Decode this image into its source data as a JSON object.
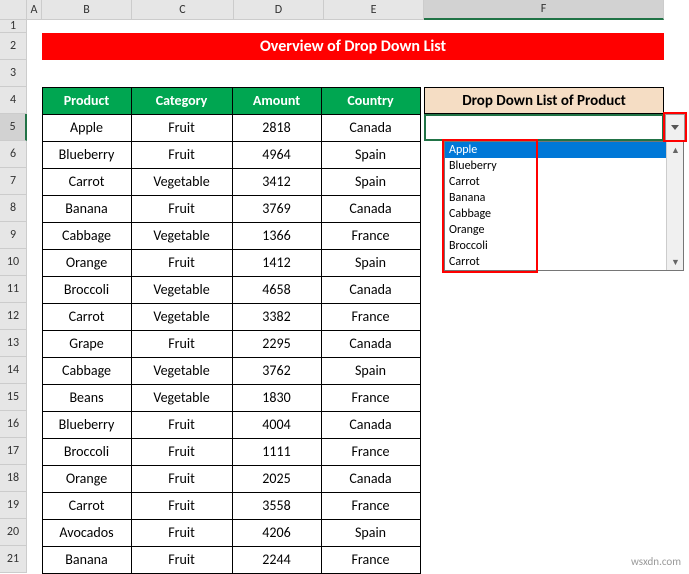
{
  "title": "Overview of Drop Down List",
  "columns": [
    "A",
    "B",
    "C",
    "D",
    "E",
    "F"
  ],
  "row_numbers": [
    "1",
    "2",
    "3",
    "4",
    "5",
    "6",
    "7",
    "8",
    "9",
    "10",
    "11",
    "12",
    "13",
    "14",
    "15",
    "16",
    "17",
    "18",
    "19",
    "20",
    "21"
  ],
  "headers": {
    "product": "Product",
    "category": "Category",
    "amount": "Amount",
    "country": "Country",
    "dropdown": "Drop Down List of Product"
  },
  "rows": [
    {
      "product": "Apple",
      "category": "Fruit",
      "amount": "2818",
      "country": "Canada"
    },
    {
      "product": "Blueberry",
      "category": "Fruit",
      "amount": "4964",
      "country": "Spain"
    },
    {
      "product": "Carrot",
      "category": "Vegetable",
      "amount": "3412",
      "country": "Spain"
    },
    {
      "product": "Banana",
      "category": "Fruit",
      "amount": "3769",
      "country": "Canada"
    },
    {
      "product": "Cabbage",
      "category": "Vegetable",
      "amount": "1366",
      "country": "France"
    },
    {
      "product": "Orange",
      "category": "Fruit",
      "amount": "1412",
      "country": "Spain"
    },
    {
      "product": "Broccoli",
      "category": "Vegetable",
      "amount": "4658",
      "country": "Canada"
    },
    {
      "product": "Carrot",
      "category": "Vegetable",
      "amount": "3382",
      "country": "France"
    },
    {
      "product": "Grape",
      "category": "Fruit",
      "amount": "2295",
      "country": "Canada"
    },
    {
      "product": "Cabbage",
      "category": "Vegetable",
      "amount": "3762",
      "country": "Spain"
    },
    {
      "product": "Beans",
      "category": "Vegetable",
      "amount": "1830",
      "country": "France"
    },
    {
      "product": "Blueberry",
      "category": "Fruit",
      "amount": "4004",
      "country": "Canada"
    },
    {
      "product": "Broccoli",
      "category": "Fruit",
      "amount": "1111",
      "country": "France"
    },
    {
      "product": "Orange",
      "category": "Fruit",
      "amount": "2025",
      "country": "Canada"
    },
    {
      "product": "Carrot",
      "category": "Fruit",
      "amount": "3558",
      "country": "France"
    },
    {
      "product": "Avocados",
      "category": "Fruit",
      "amount": "4206",
      "country": "Spain"
    },
    {
      "product": "Banana",
      "category": "Fruit",
      "amount": "2244",
      "country": "France"
    }
  ],
  "dropdown_items": [
    "Apple",
    "Blueberry",
    "Carrot",
    "Banana",
    "Cabbage",
    "Orange",
    "Broccoli",
    "Carrot"
  ],
  "watermark": "wsxdn.com"
}
